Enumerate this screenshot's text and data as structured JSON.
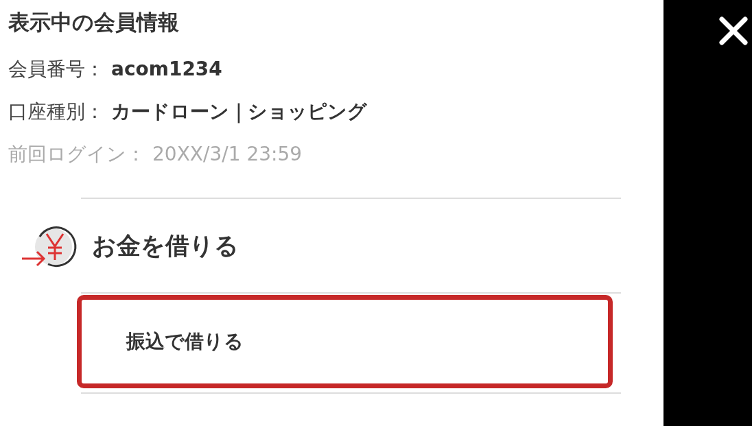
{
  "member_info": {
    "title": "表示中の会員情報",
    "rows": [
      {
        "label": "会員番号：",
        "value": "acom1234"
      },
      {
        "label": "口座種別：",
        "value": "カードローン｜ショッピング"
      }
    ],
    "last_login": {
      "label": "前回ログイン：",
      "value": "20XX/3/1 23:59"
    }
  },
  "section": {
    "title": "お金を借りる",
    "items": [
      {
        "label": "振込で借りる",
        "highlighted": true
      }
    ]
  }
}
